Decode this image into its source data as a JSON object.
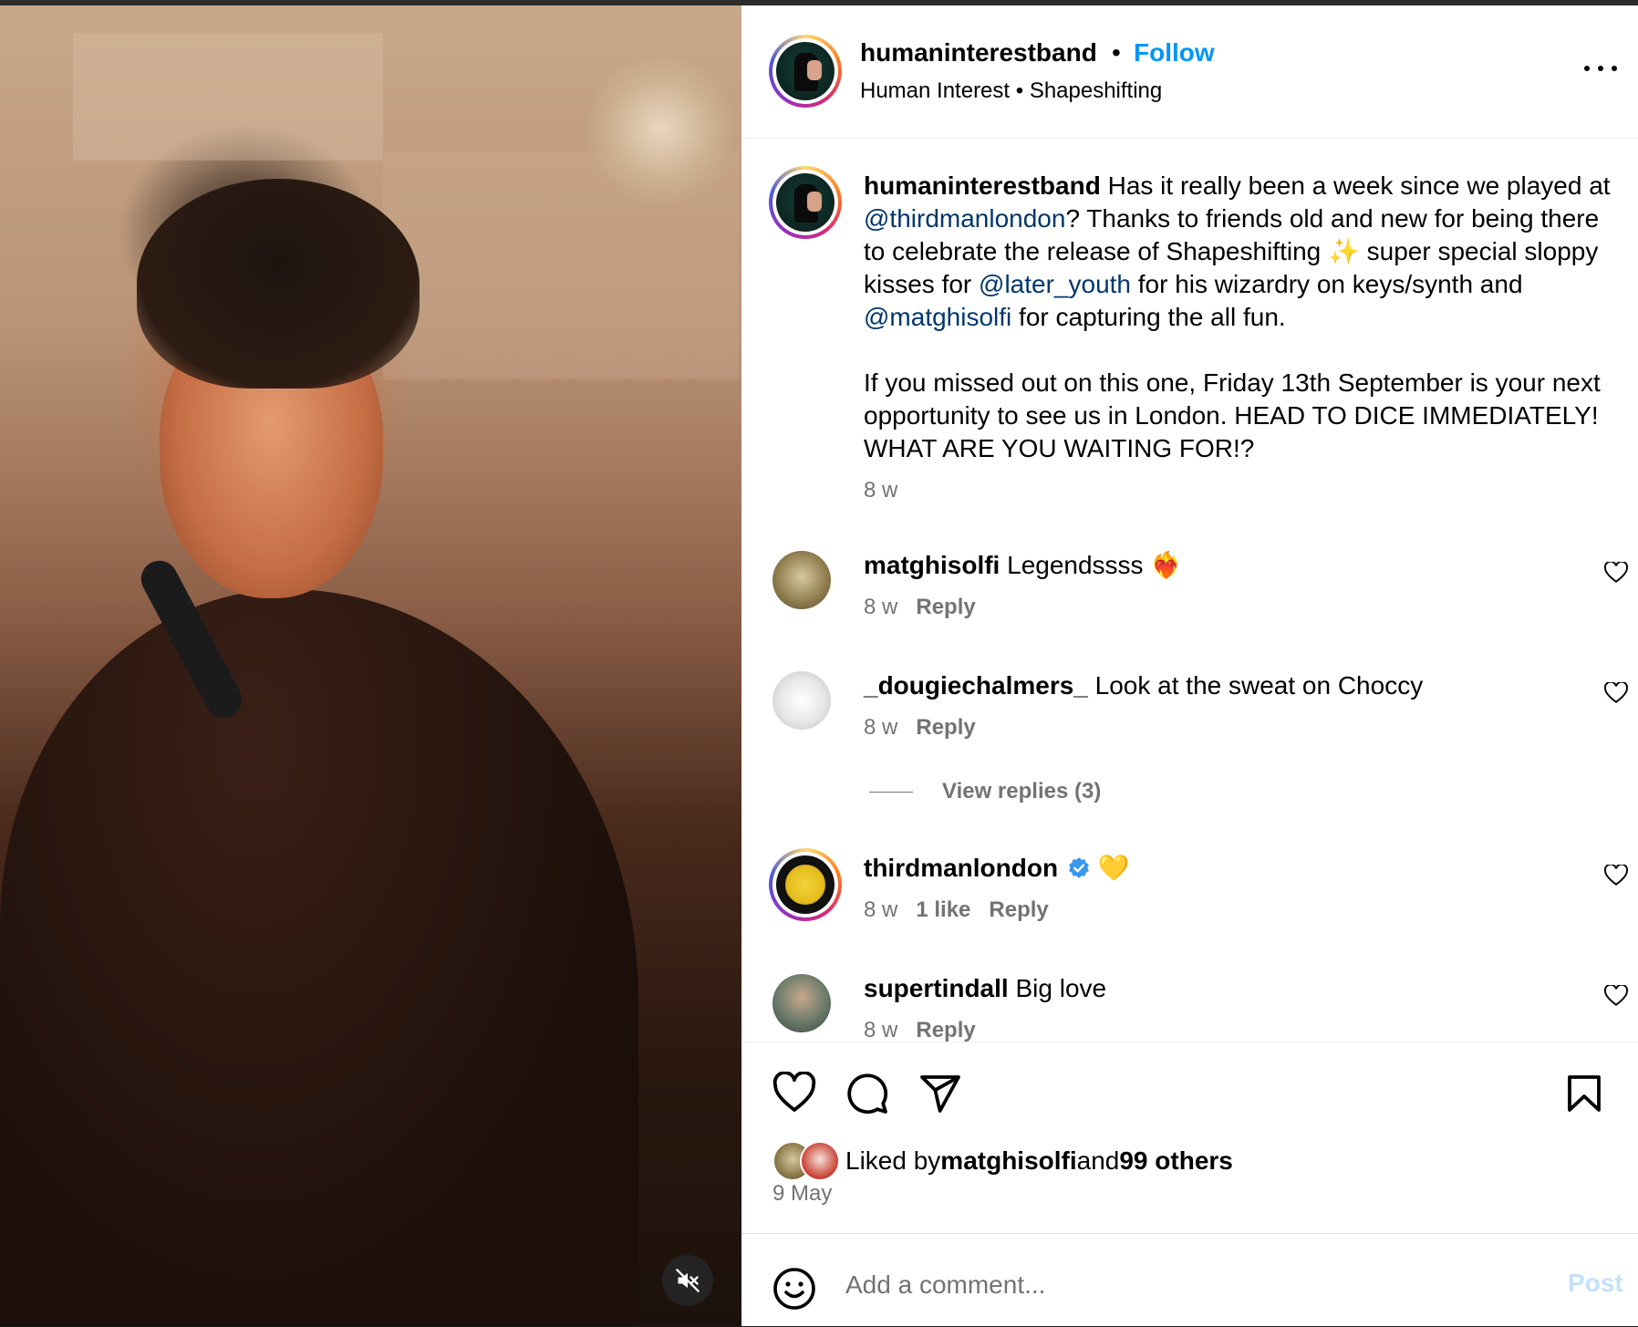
{
  "header": {
    "username": "humaninterestband",
    "dot": "•",
    "follow_label": "Follow",
    "subtitle": "Human Interest • Shapeshifting"
  },
  "caption": {
    "username": "humaninterestband",
    "text_1": " Has it really been a week since we played at ",
    "mention_1": "@thirdmanlondon",
    "text_2": "? Thanks to friends old and new for being there to celebrate the release of Shapeshifting ✨ super special sloppy kisses for ",
    "mention_2": "@later_youth",
    "text_3": " for his wizardry on keys/synth and ",
    "mention_3": "@matghisolfi",
    "text_4": " for capturing the all fun.",
    "paragraph_2": "If you missed out on this one, Friday 13th September is your next opportunity to see us in London. HEAD TO DICE IMMEDIATELY! WHAT ARE YOU WAITING FOR!?",
    "time": "8 w"
  },
  "comments": [
    {
      "username": "matghisolfi",
      "text": "Legendssss ❤️‍🔥",
      "time": "8 w",
      "likes": "",
      "reply_label": "Reply"
    },
    {
      "username": "_dougiechalmers_",
      "text": "Look at the sweat on Choccy",
      "time": "8 w",
      "likes": "",
      "reply_label": "Reply",
      "view_replies": "View replies (3)"
    },
    {
      "username": "thirdmanlondon",
      "text": "💛",
      "time": "8 w",
      "likes": "1 like",
      "reply_label": "Reply",
      "verified": true
    },
    {
      "username": "supertindall",
      "text": "Big love",
      "time": "8 w",
      "likes": "",
      "reply_label": "Reply"
    }
  ],
  "actions": {
    "icons": [
      "heart-icon",
      "comment-icon",
      "share-icon",
      "bookmark-icon"
    ]
  },
  "likes": {
    "prefix": "Liked by ",
    "user": "matghisolfi",
    "middle": " and ",
    "others": "99 others"
  },
  "date": "9 May",
  "add_comment": {
    "placeholder": "Add a comment...",
    "post_label": "Post"
  },
  "colors": {
    "accent": "#0095f6",
    "mention": "#00376b",
    "secondary_text": "#737373",
    "post_disabled": "#c4e0fd"
  }
}
